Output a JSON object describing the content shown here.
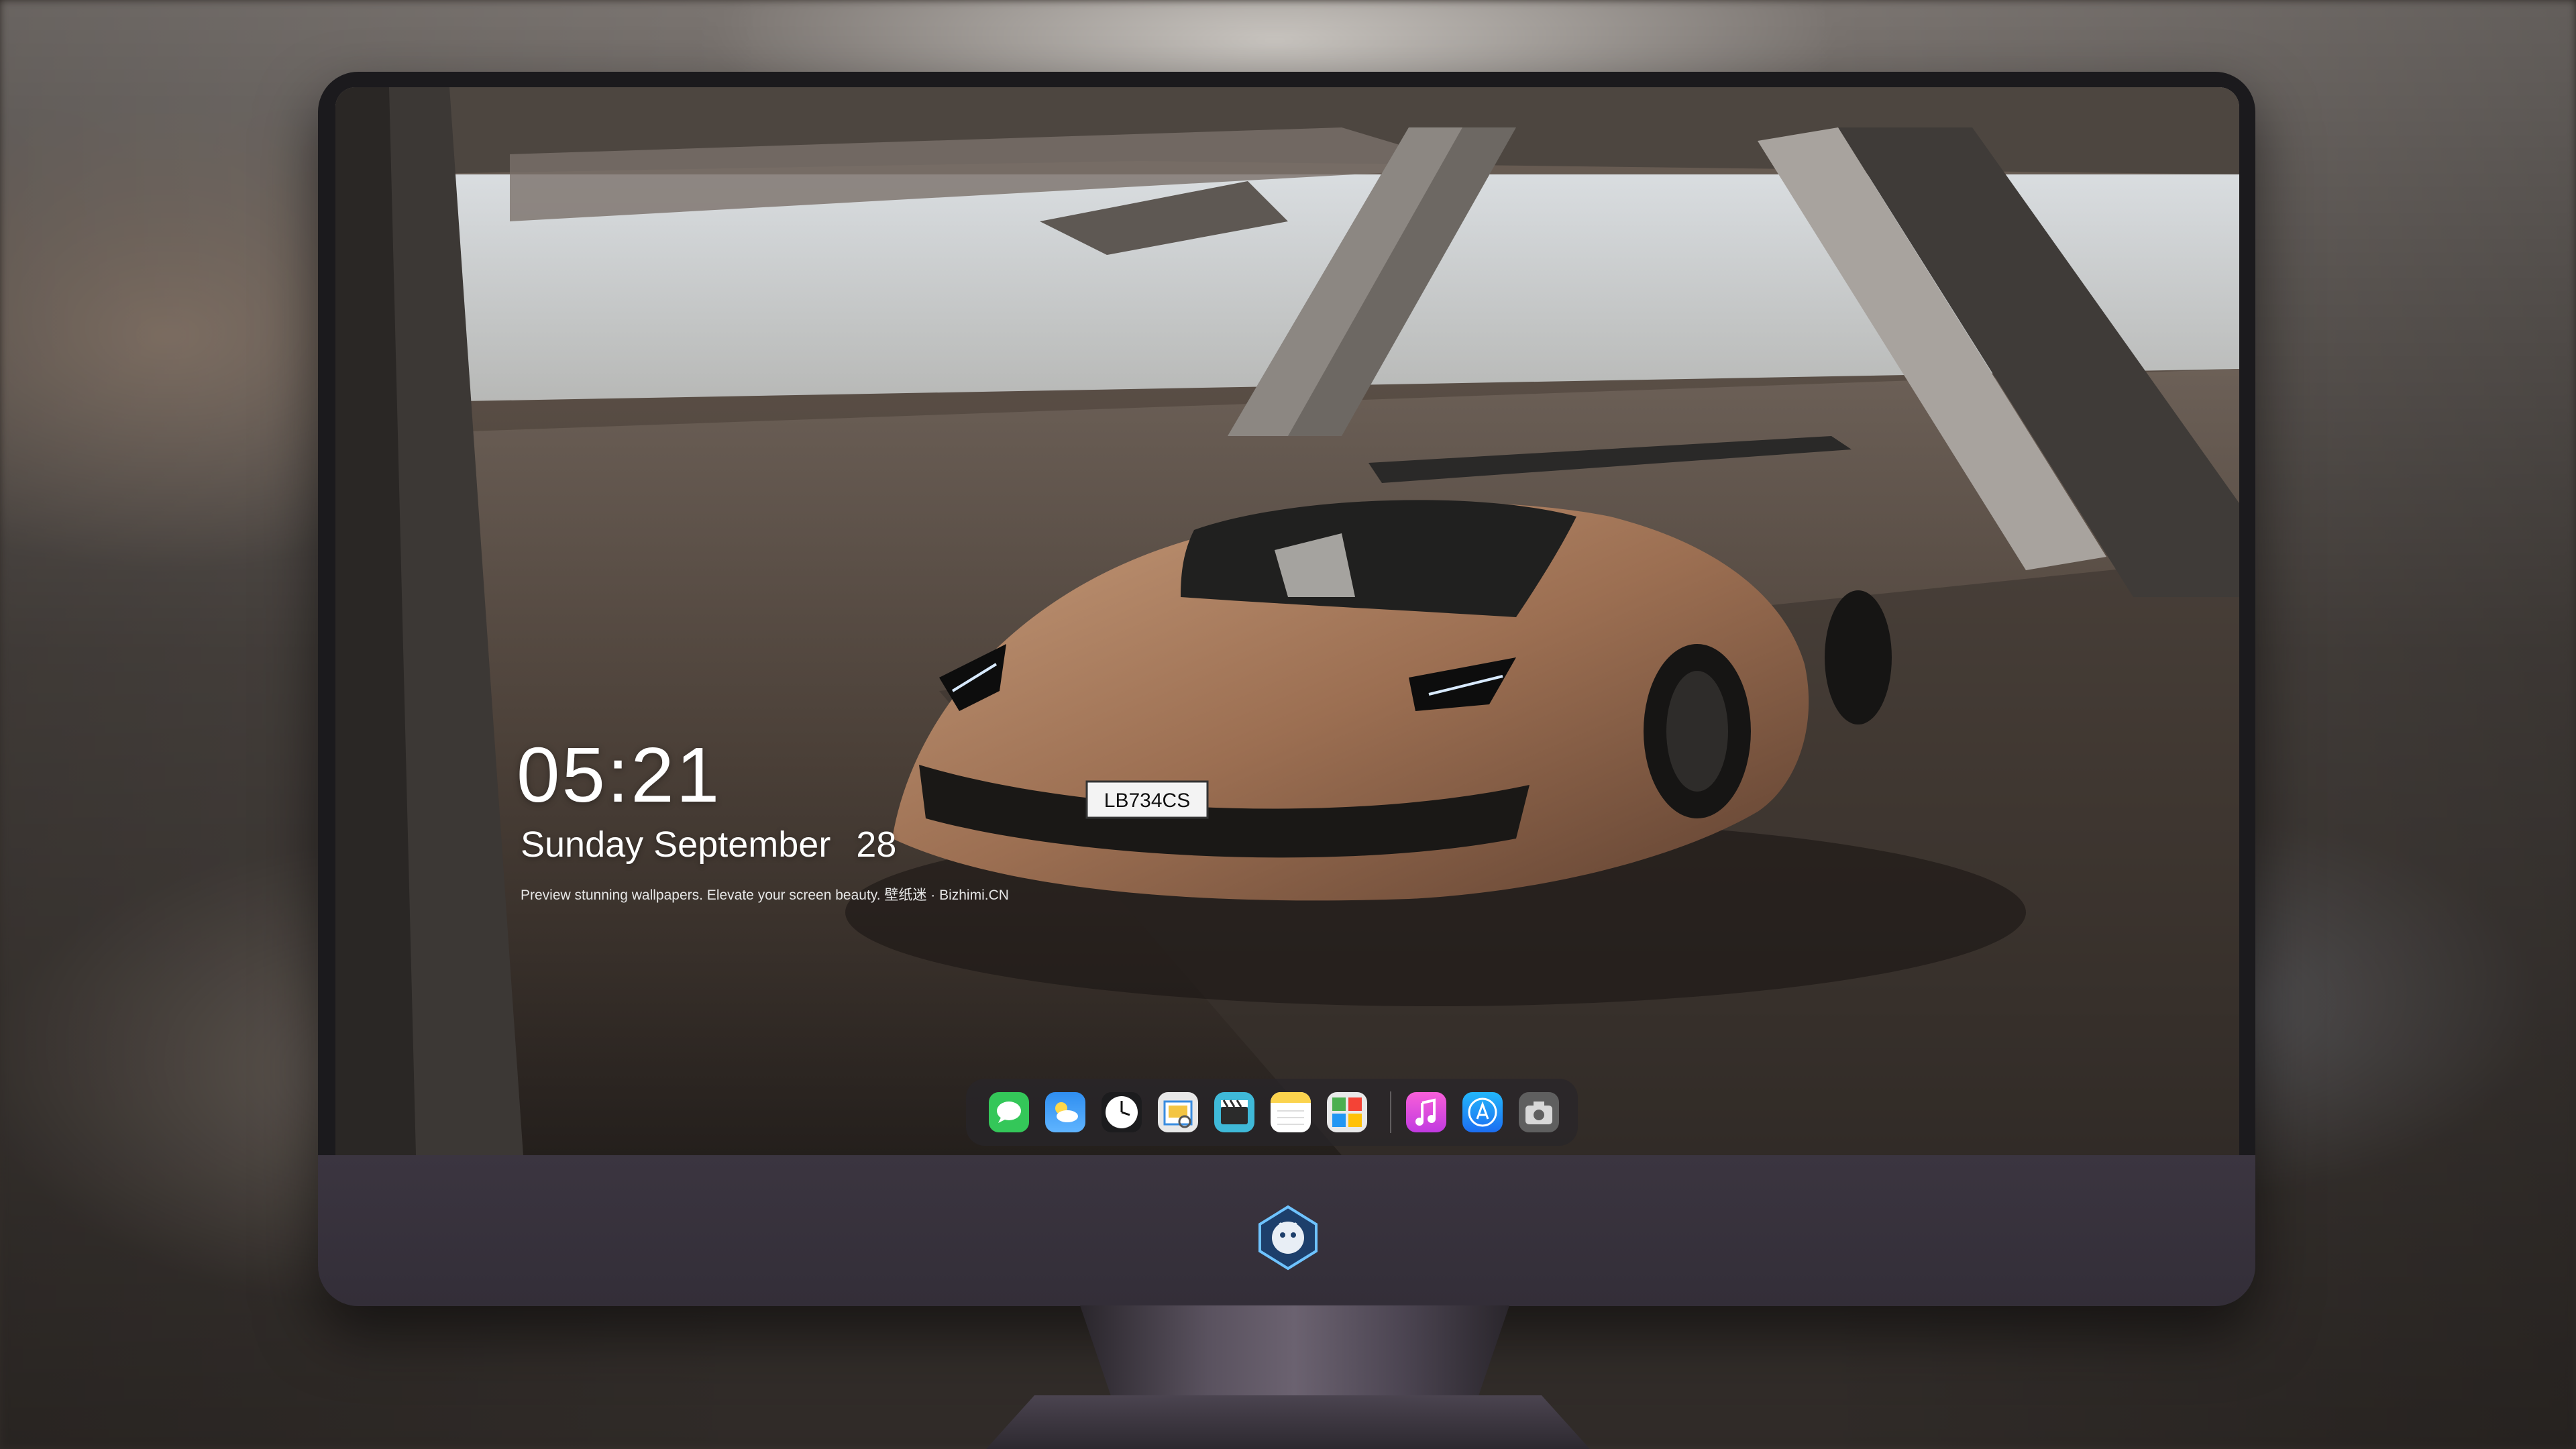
{
  "lock_screen": {
    "time": "05:21",
    "date_text": "Sunday September",
    "date_day": "28",
    "tagline": "Preview stunning wallpapers. Elevate your screen beauty. 壁纸迷 · Bizhimi.CN"
  },
  "car": {
    "plate": "LB734CS"
  },
  "dock": {
    "apps": [
      {
        "name": "Messages",
        "icon": "messages-icon",
        "color": "#34c759"
      },
      {
        "name": "Weather",
        "icon": "weather-icon",
        "color": "#2f8ef0"
      },
      {
        "name": "Clock",
        "icon": "clock-icon",
        "color": "#ffffff"
      },
      {
        "name": "Preview",
        "icon": "preview-icon",
        "color": "#e8e8e8"
      },
      {
        "name": "Clips",
        "icon": "clips-icon",
        "color": "#3fb9d8"
      },
      {
        "name": "Notes",
        "icon": "notes-icon",
        "color": "#fbd34d"
      },
      {
        "name": "Photo Booth",
        "icon": "photo-booth-icon",
        "color": "#e9e9e9"
      },
      {
        "name": "Music",
        "icon": "music-icon",
        "color": "#f14fd0"
      },
      {
        "name": "App Store",
        "icon": "app-store-icon",
        "color": "#1c8ef9"
      },
      {
        "name": "Screenshot",
        "icon": "camera-icon",
        "color": "#6b6b6b"
      }
    ]
  },
  "monitor": {
    "logo": "dragon-badge-logo",
    "accent": "#332e38"
  }
}
